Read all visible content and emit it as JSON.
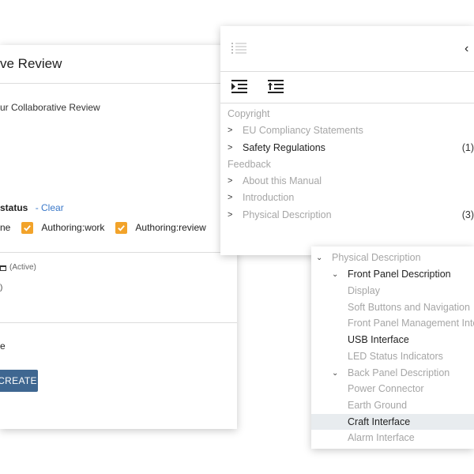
{
  "review": {
    "title": "ve Review",
    "description": "ur Collaborative Review",
    "status_label": "status",
    "clear_label": "- Clear",
    "checkboxes": [
      {
        "label": "ne"
      },
      {
        "label": "Authoring:work",
        "checked": true
      },
      {
        "label": "Authoring:review",
        "checked": true
      }
    ],
    "active_label": "(Active)",
    "dot_text": ")",
    "e_text": "e",
    "create_label": "CREATE",
    "accent_color": "#f2a32a",
    "button_color": "#3f6791",
    "link_color": "#3a78c9"
  },
  "toc": {
    "icons": [
      "list-icon",
      "back-chevron-icon",
      "outdent-icon",
      "indent-icon"
    ],
    "items": [
      {
        "label": "Copyright",
        "style": "gray",
        "chevron": false,
        "count": ""
      },
      {
        "label": "EU Compliancy Statements",
        "style": "gray",
        "chevron": true,
        "count": ""
      },
      {
        "label": "Safety Regulations",
        "style": "dark",
        "chevron": true,
        "count": "(1)"
      },
      {
        "label": "Feedback",
        "style": "gray",
        "chevron": false,
        "count": ""
      },
      {
        "label": "About this Manual",
        "style": "gray",
        "chevron": true,
        "count": ""
      },
      {
        "label": "Introduction",
        "style": "gray",
        "chevron": true,
        "count": ""
      },
      {
        "label": "Physical Description",
        "style": "gray",
        "chevron": true,
        "count": "(3)"
      }
    ]
  },
  "tree": {
    "items": [
      {
        "label": "Physical Description",
        "level": 0,
        "expanded": true,
        "style": "gray"
      },
      {
        "label": "Front Panel Description",
        "level": 1,
        "expanded": true,
        "style": "dark"
      },
      {
        "label": "Display",
        "level": 2,
        "style": "gray"
      },
      {
        "label": "Soft Buttons and Navigation",
        "level": 2,
        "style": "gray"
      },
      {
        "label": "Front Panel Management Inte",
        "level": 2,
        "style": "gray"
      },
      {
        "label": "USB Interface",
        "level": 2,
        "style": "dark"
      },
      {
        "label": "LED Status Indicators",
        "level": 2,
        "style": "gray"
      },
      {
        "label": "Back Panel Description",
        "level": 1,
        "expanded": true,
        "style": "gray"
      },
      {
        "label": "Power Connector",
        "level": 2,
        "style": "gray"
      },
      {
        "label": "Earth Ground",
        "level": 2,
        "style": "gray"
      },
      {
        "label": "Craft Interface",
        "level": 2,
        "style": "dark",
        "selected": true
      },
      {
        "label": "Alarm Interface",
        "level": 2,
        "style": "gray"
      }
    ]
  }
}
